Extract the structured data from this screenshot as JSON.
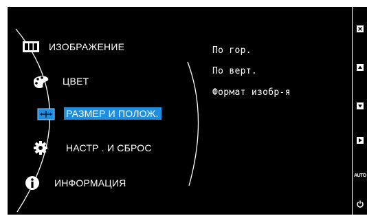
{
  "menu": {
    "items": [
      {
        "label": "ИЗОБРАЖЕНИЕ",
        "icon": "picture-icon",
        "selected": false
      },
      {
        "label": "ЦВЕТ",
        "icon": "palette-icon",
        "selected": false
      },
      {
        "label": "РАЗМЕР И ПОЛОЖ.",
        "icon": "size-position-icon",
        "selected": true
      },
      {
        "label": "НАСТР . И СБРОС",
        "icon": "gear-icon",
        "selected": false
      },
      {
        "label": "ИНФОРМАЦИЯ",
        "icon": "info-icon",
        "selected": false
      }
    ]
  },
  "submenu": {
    "items": [
      {
        "label": "По гор."
      },
      {
        "label": "По верт."
      },
      {
        "label": "Формат изобр-я"
      }
    ]
  },
  "keys": {
    "auto_label": "AUTO",
    "items": [
      "close-key",
      "up-key",
      "down-key",
      "enter-key",
      "auto-key",
      "power-key"
    ]
  },
  "colors": {
    "background": "#000000",
    "text": "#ffffff",
    "selection": "#1e8ee0"
  }
}
